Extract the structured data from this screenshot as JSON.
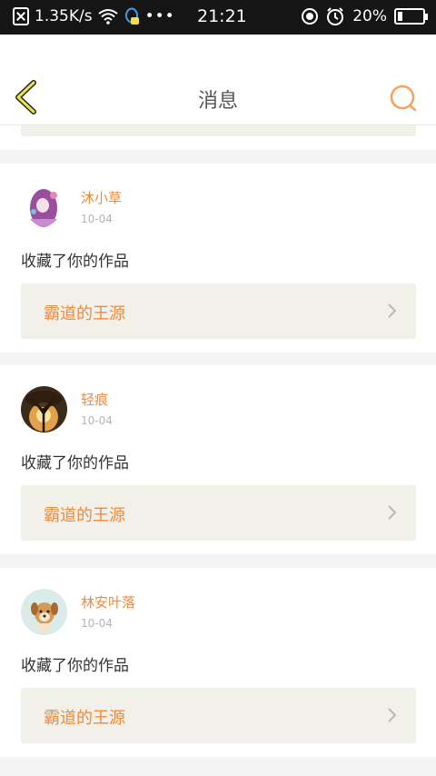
{
  "status_bar": {
    "net_speed": "1.35K/s",
    "time": "21:21",
    "battery": "20%",
    "battery_level": 0.2
  },
  "header": {
    "title": "消息",
    "back_icon": "chevron-left-icon",
    "search_icon": "search-icon"
  },
  "colors": {
    "accent": "#f08a3c",
    "back_yellow": "#f2e04a",
    "work_bg": "#f1f1ea"
  },
  "messages": [
    {
      "user": "沐小草",
      "date": "10-04",
      "action": "收藏了你的作品",
      "work": "霸道的王源"
    },
    {
      "user": "轻痕",
      "date": "10-04",
      "action": "收藏了你的作品",
      "work": "霸道的王源"
    },
    {
      "user": "林安叶落",
      "date": "10-04",
      "action": "收藏了你的作品",
      "work": "霸道的王源"
    }
  ]
}
